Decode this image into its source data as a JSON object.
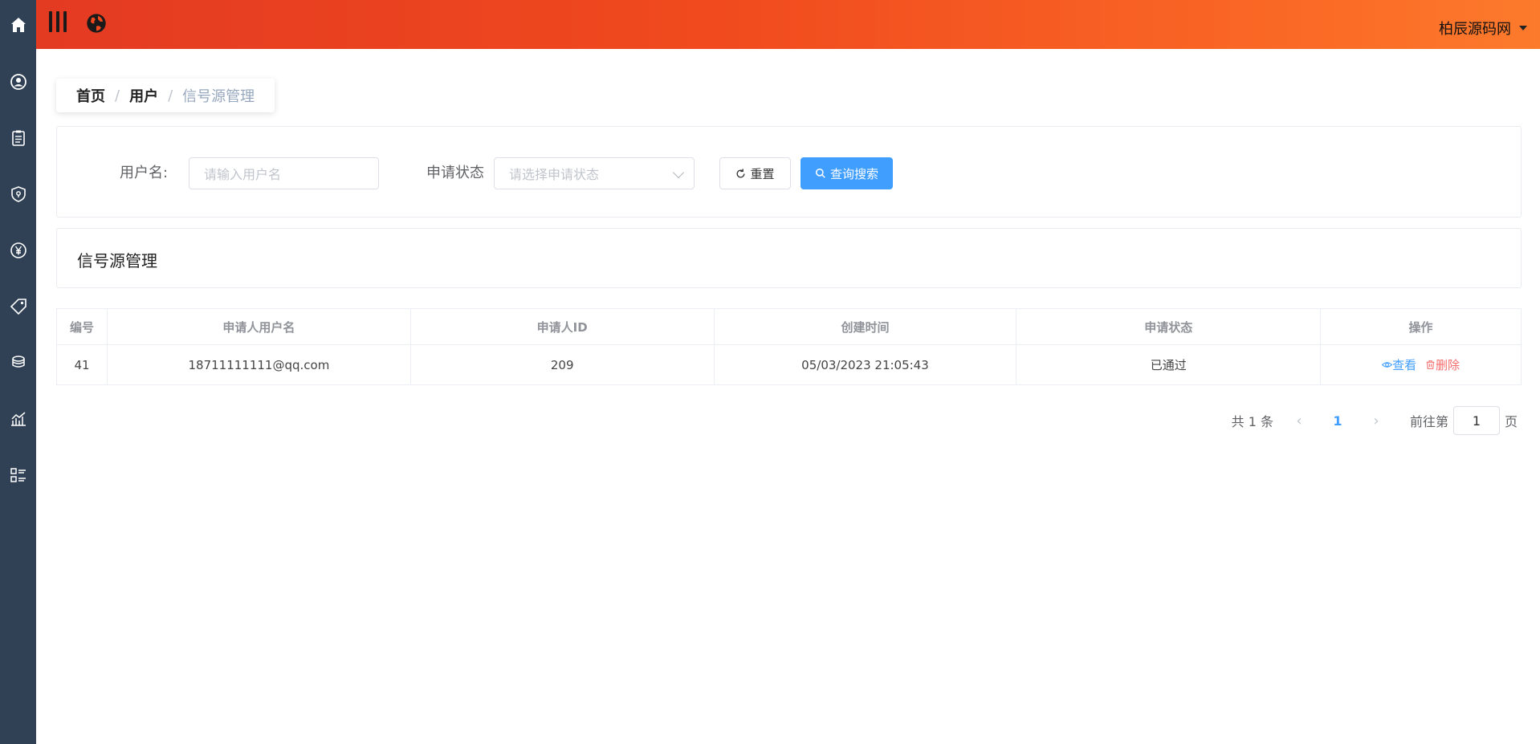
{
  "sidebar": {
    "icons": [
      "home-icon",
      "user-circle-icon",
      "clipboard-icon",
      "shield-icon",
      "yen-icon",
      "tag-icon",
      "coins-icon",
      "chart-icon",
      "list-icon"
    ]
  },
  "topbar": {
    "user_name": "柏辰源码网"
  },
  "breadcrumb": {
    "home": "首页",
    "user": "用户",
    "separator": "/",
    "current": "信号源管理"
  },
  "search": {
    "username_label": "用户名:",
    "username_placeholder": "请输入用户名",
    "status_label": "申请状态",
    "status_placeholder": "请选择申请状态",
    "reset_label": "重置",
    "search_label": "查询搜索"
  },
  "panel": {
    "title": "信号源管理"
  },
  "table": {
    "headers": [
      "编号",
      "申请人用户名",
      "申请人ID",
      "创建时间",
      "申请状态",
      "操作"
    ],
    "rows": [
      {
        "id": "41",
        "username": "18711111111@qq.com",
        "user_id": "209",
        "created": "05/03/2023 21:05:43",
        "status": "已通过",
        "view": "查看",
        "delete": "删除"
      }
    ]
  },
  "pagination": {
    "total": "共 1 条",
    "current_page": "1",
    "goto_prefix": "前往第",
    "goto_value": "1",
    "goto_suffix": "页"
  },
  "colors": {
    "sidebar": "#304156",
    "primary": "#409eff",
    "danger": "#f56c6c",
    "topbar_start": "#e33a22",
    "topbar_end": "#fc7a2c"
  }
}
